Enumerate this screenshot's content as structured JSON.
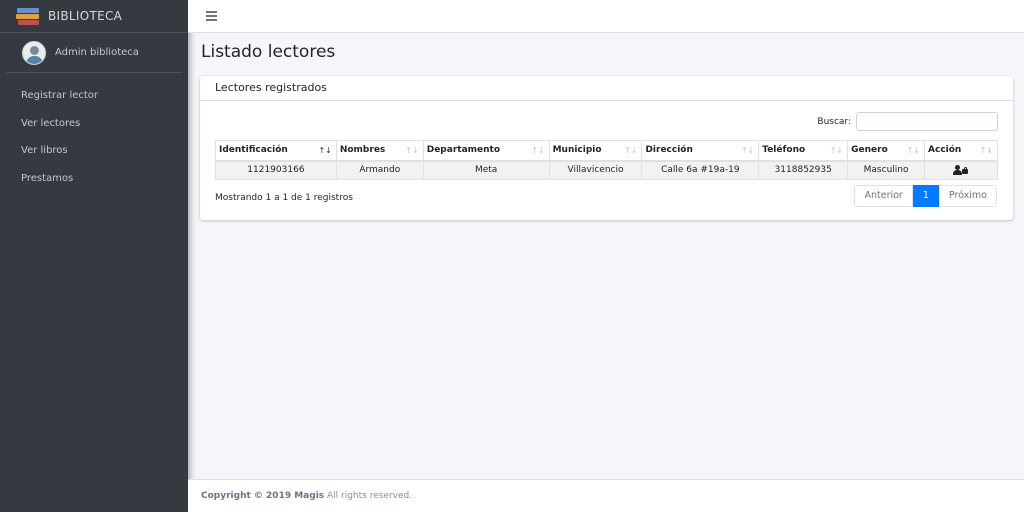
{
  "brand": {
    "name": "BIBLIOTECA"
  },
  "user": {
    "name": "Admin biblioteca"
  },
  "sidebar": {
    "items": [
      {
        "label": "Registrar lector"
      },
      {
        "label": "Ver lectores"
      },
      {
        "label": "Ver libros"
      },
      {
        "label": "Prestamos"
      }
    ]
  },
  "page": {
    "title": "Listado lectores"
  },
  "card": {
    "title": "Lectores registrados",
    "search_label": "Buscar:",
    "search_value": ""
  },
  "table": {
    "columns": [
      "Identificación",
      "Nombres",
      "Departamento",
      "Municipio",
      "Dirección",
      "Teléfono",
      "Genero",
      "Acción"
    ],
    "sort_column": "Identificación",
    "rows": [
      {
        "identificacion": "1121903166",
        "nombres": "Armando",
        "departamento": "Meta",
        "municipio": "Villavicencio",
        "direccion": "Calle 6a #19a-19",
        "telefono": "3118852935",
        "genero": "Masculino",
        "accion_icon": "user-lock-icon"
      }
    ]
  },
  "info": "Mostrando 1 a 1 de 1 registros",
  "pagination": {
    "previous": "Anterior",
    "current": "1",
    "next": "Próximo"
  },
  "footer": {
    "copyright": "Copyright © 2019 Magis",
    "rights": " All rights reserved."
  },
  "colors": {
    "sidebar": "#343a40",
    "accent": "#007bff",
    "background": "#f4f6f9"
  }
}
